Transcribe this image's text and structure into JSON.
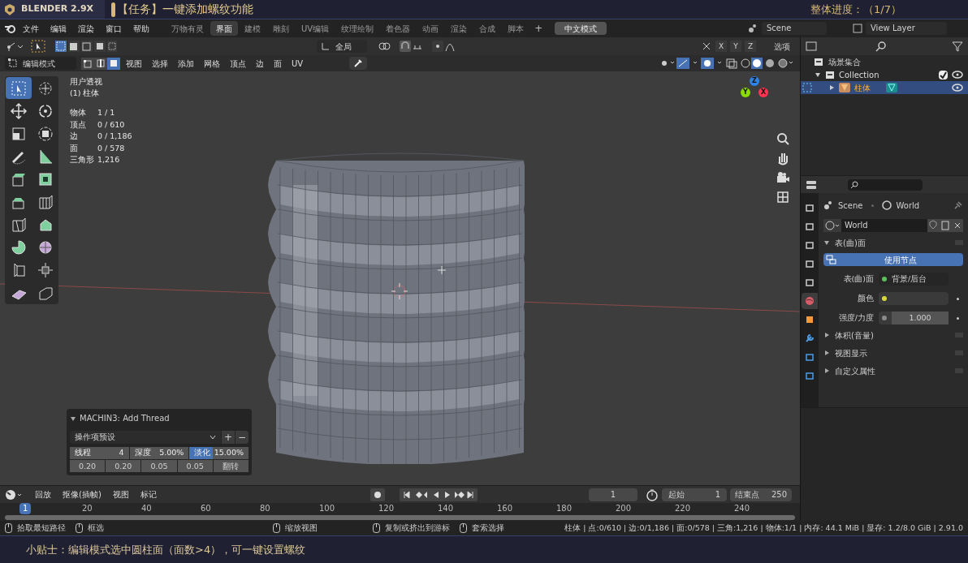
{
  "title_bar": {
    "app": "BLENDER 2.9X",
    "task": "【任务】一键添加螺纹功能",
    "progress": "整体进度：（1/7）"
  },
  "menu_bar": {
    "menus": [
      "文件",
      "编辑",
      "渲染",
      "窗口",
      "帮助"
    ],
    "workspaces": [
      {
        "label": "万物有灵",
        "selected": false
      },
      {
        "label": "界面",
        "selected": true
      },
      {
        "label": "建模",
        "selected": false
      },
      {
        "label": "雕刻",
        "selected": false
      },
      {
        "label": "UV编辑",
        "selected": false
      },
      {
        "label": "纹理绘制",
        "selected": false
      },
      {
        "label": "着色器",
        "selected": false
      },
      {
        "label": "动画",
        "selected": false
      },
      {
        "label": "渲染",
        "selected": false
      },
      {
        "label": "合成",
        "selected": false
      },
      {
        "label": "脚本",
        "selected": false
      }
    ],
    "add_tab": "+",
    "mode_button": "中文模式",
    "scene": "Scene",
    "view_layer": "View Layer"
  },
  "tool_header": {
    "orientation": "全局",
    "mirror_axes": [
      "X",
      "Y",
      "Z"
    ],
    "options": "选项"
  },
  "edit_header": {
    "mode": "编辑模式",
    "select_modes": [
      {
        "kind": "vertex",
        "selected": false
      },
      {
        "kind": "edge",
        "selected": false
      },
      {
        "kind": "face",
        "selected": true
      }
    ],
    "menus": [
      "视图",
      "选择",
      "添加",
      "网格",
      "顶点",
      "边",
      "面",
      "UV"
    ]
  },
  "viewport": {
    "view_name": "用户透视",
    "object": "(1) 柱体",
    "stats": [
      {
        "label": "物体",
        "value": "1 / 1"
      },
      {
        "label": "顶点",
        "value": "0 / 610"
      },
      {
        "label": "边",
        "value": "0 / 1,186"
      },
      {
        "label": "面",
        "value": "0 / 578"
      },
      {
        "label": "三角形",
        "value": "1,216"
      }
    ],
    "tools": [
      {
        "kind": "select",
        "selected": true
      },
      {
        "kind": "cursor",
        "selected": false
      },
      {
        "kind": "move",
        "selected": false
      },
      {
        "kind": "rotate",
        "selected": false
      },
      {
        "kind": "scale",
        "selected": false
      },
      {
        "kind": "transform",
        "selected": false
      },
      {
        "kind": "annotate",
        "selected": false
      },
      {
        "kind": "measure",
        "selected": false
      },
      {
        "kind": "extrude",
        "selected": false
      },
      {
        "kind": "inset",
        "selected": false
      },
      {
        "kind": "bevel",
        "selected": false
      },
      {
        "kind": "loopcut",
        "selected": false
      },
      {
        "kind": "knife",
        "selected": false
      },
      {
        "kind": "polybuild",
        "selected": false
      },
      {
        "kind": "spin",
        "selected": false
      },
      {
        "kind": "smooth",
        "selected": false
      },
      {
        "kind": "edgeslide",
        "selected": false
      },
      {
        "kind": "shrink",
        "selected": false
      },
      {
        "kind": "shear",
        "selected": false
      },
      {
        "kind": "rip",
        "selected": false
      }
    ],
    "gizmo_axes": [
      "Z",
      "Y",
      "X"
    ]
  },
  "operator_panel": {
    "title": "MACHIN3: Add Thread",
    "preset": "操作项预设",
    "add": "+",
    "remove": "−",
    "fields": [
      {
        "label": "线程",
        "value": "4",
        "selected": false
      },
      {
        "label": "深度",
        "value": "5.00%",
        "selected": false
      },
      {
        "label": "淡化",
        "value": "15.00%",
        "selected": true
      }
    ],
    "values": [
      "0.20",
      "0.20",
      "0.05",
      "0.05"
    ],
    "flip": "翻转"
  },
  "timeline": {
    "menus": [
      "回放",
      "抠像(插帧)",
      "视图",
      "标记"
    ],
    "current_frame": "1",
    "start_label": "起始",
    "start": "1",
    "end_label": "结束点",
    "end": "250",
    "ticks": [
      {
        "label": "1",
        "selected": true
      },
      {
        "label": "20",
        "selected": false
      },
      {
        "label": "40",
        "selected": false
      },
      {
        "label": "60",
        "selected": false
      },
      {
        "label": "80",
        "selected": false
      },
      {
        "label": "100",
        "selected": false
      },
      {
        "label": "120",
        "selected": false
      },
      {
        "label": "140",
        "selected": false
      },
      {
        "label": "160",
        "selected": false
      },
      {
        "label": "180",
        "selected": false
      },
      {
        "label": "200",
        "selected": false
      },
      {
        "label": "220",
        "selected": false
      },
      {
        "label": "240",
        "selected": false
      }
    ]
  },
  "outliner": {
    "root": "场景集合",
    "items": [
      {
        "label": "Collection",
        "expanded": true,
        "checked": true,
        "selected": false,
        "children": [
          {
            "label": "柱体",
            "expanded": false,
            "selected": true
          }
        ]
      }
    ]
  },
  "properties": {
    "tabs": [
      {
        "kind": "tool",
        "selected": false
      },
      {
        "kind": "render",
        "selected": false
      },
      {
        "kind": "output",
        "selected": false
      },
      {
        "kind": "view_layer",
        "selected": false
      },
      {
        "kind": "scene",
        "selected": false
      },
      {
        "kind": "world",
        "selected": true
      },
      {
        "kind": "object",
        "selected": false
      },
      {
        "kind": "modifier",
        "selected": false
      },
      {
        "kind": "particles",
        "selected": false
      },
      {
        "kind": "physics",
        "selected": false
      }
    ],
    "breadcrumb": [
      "Scene",
      "World"
    ],
    "world_name": "World",
    "surface_panel": {
      "label": "表(曲)面",
      "expanded": true
    },
    "use_nodes": "使用节点",
    "rows": [
      {
        "label": "表(曲)面",
        "value": "背景/后台",
        "color": "#5cc15c"
      },
      {
        "label": "颜色",
        "color": "#d8d83a"
      },
      {
        "label": "强度/力度",
        "value": "1.000",
        "color": "#8a8a8a"
      }
    ],
    "panels": [
      {
        "label": "体积(音量)",
        "expanded": false
      },
      {
        "label": "视图显示",
        "expanded": false
      },
      {
        "label": "自定义属性",
        "expanded": false
      }
    ]
  },
  "status_bar": {
    "hints": [
      "拾取最短路径",
      "框选",
      "缩放视图",
      "复制或挤出到游标",
      "套索选择"
    ],
    "info": "柱体 | 点:0/610 | 边:0/1,186 | 面:0/578 | 三角:1,216 | 物体:1/1 | 内存: 44.1 MiB | 显存: 1.2/8.0 GiB | 2.91.0"
  },
  "tip": "小贴士：编辑模式选中圆柱面（面数>4），可一键设置螺纹"
}
